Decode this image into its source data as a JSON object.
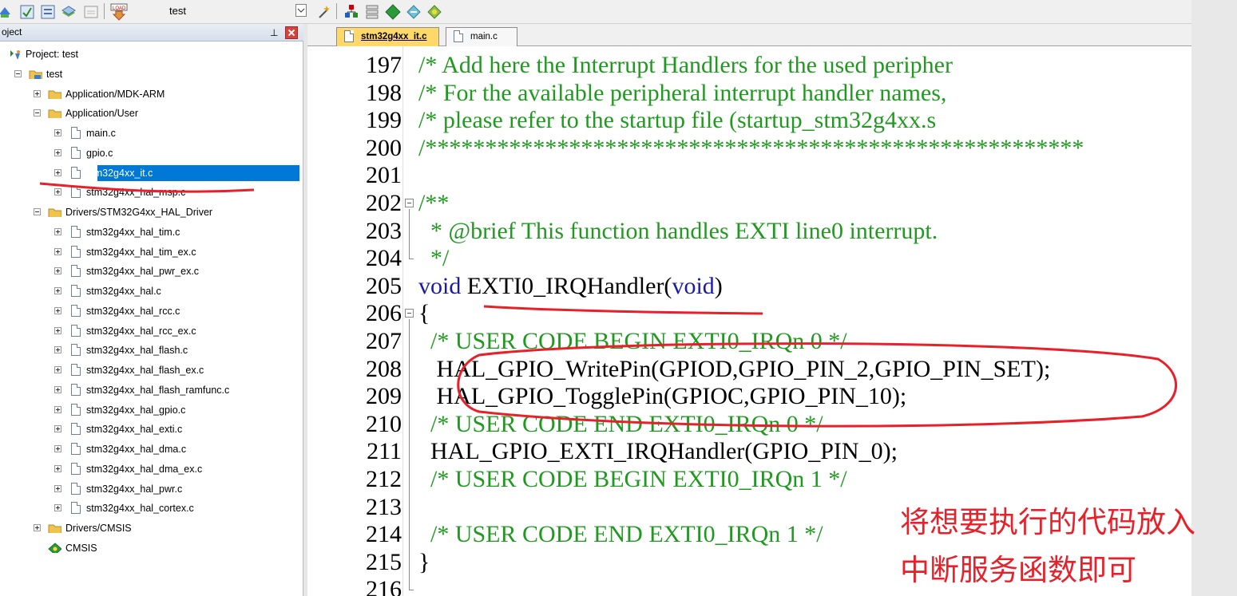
{
  "toolbar": {
    "target_name": "test",
    "icons": [
      "translate-icon",
      "build-icon",
      "rebuild-icon",
      "batch-build-icon",
      "stop-build-icon",
      "download-icon",
      "target-options-icon",
      "manage-project-icon",
      "manage-components-icon",
      "pack-installer-icon",
      "event-recorder-icon",
      "select-packs-icon"
    ],
    "download_label": "LOAD"
  },
  "project_panel": {
    "title": "oject",
    "pin_symbol": "⊥",
    "items": [
      {
        "label": "Project: test",
        "type": "project"
      },
      {
        "label": "test",
        "type": "target"
      },
      {
        "label": "Application/MDK-ARM",
        "type": "folder"
      },
      {
        "label": "Application/User",
        "type": "folder"
      },
      {
        "label": "main.c",
        "type": "file"
      },
      {
        "label": "gpio.c",
        "type": "file"
      },
      {
        "label": "stm32g4xx_it.c",
        "type": "file",
        "selected": true
      },
      {
        "label": "stm32g4xx_hal_msp.c",
        "type": "file"
      },
      {
        "label": "Drivers/STM32G4xx_HAL_Driver",
        "type": "folder"
      },
      {
        "label": "stm32g4xx_hal_tim.c",
        "type": "file"
      },
      {
        "label": "stm32g4xx_hal_tim_ex.c",
        "type": "file"
      },
      {
        "label": "stm32g4xx_hal_pwr_ex.c",
        "type": "file"
      },
      {
        "label": "stm32g4xx_hal.c",
        "type": "file"
      },
      {
        "label": "stm32g4xx_hal_rcc.c",
        "type": "file"
      },
      {
        "label": "stm32g4xx_hal_rcc_ex.c",
        "type": "file"
      },
      {
        "label": "stm32g4xx_hal_flash.c",
        "type": "file"
      },
      {
        "label": "stm32g4xx_hal_flash_ex.c",
        "type": "file"
      },
      {
        "label": "stm32g4xx_hal_flash_ramfunc.c",
        "type": "file"
      },
      {
        "label": "stm32g4xx_hal_gpio.c",
        "type": "file"
      },
      {
        "label": "stm32g4xx_hal_exti.c",
        "type": "file"
      },
      {
        "label": "stm32g4xx_hal_dma.c",
        "type": "file"
      },
      {
        "label": "stm32g4xx_hal_dma_ex.c",
        "type": "file"
      },
      {
        "label": "stm32g4xx_hal_pwr.c",
        "type": "file"
      },
      {
        "label": "stm32g4xx_hal_cortex.c",
        "type": "file"
      },
      {
        "label": "Drivers/CMSIS",
        "type": "folder"
      },
      {
        "label": "CMSIS",
        "type": "component"
      }
    ]
  },
  "editor": {
    "tabs": [
      {
        "label": "stm32g4xx_it.c",
        "active": true
      },
      {
        "label": "main.c",
        "active": false
      }
    ],
    "lines": [
      {
        "n": "197",
        "parts": [
          {
            "t": "/* Add here the Interrupt Handlers for the used peripher",
            "c": "cmt"
          }
        ]
      },
      {
        "n": "198",
        "parts": [
          {
            "t": "/* For the available peripheral interrupt handler names,",
            "c": "cmt"
          }
        ]
      },
      {
        "n": "199",
        "parts": [
          {
            "t": "/* please refer to the startup file (startup_stm32g4xx.s",
            "c": "cmt"
          }
        ]
      },
      {
        "n": "200",
        "parts": [
          {
            "t": "/*******************************************************",
            "c": "cmt"
          }
        ]
      },
      {
        "n": "201",
        "parts": []
      },
      {
        "n": "202",
        "parts": [
          {
            "t": "/**",
            "c": "cmt"
          }
        ]
      },
      {
        "n": "203",
        "parts": [
          {
            "t": "  * @brief This function handles EXTI line0 interrupt.",
            "c": "cmt"
          }
        ]
      },
      {
        "n": "204",
        "parts": [
          {
            "t": "  */",
            "c": "cmt"
          }
        ]
      },
      {
        "n": "205",
        "parts": [
          {
            "t": "void",
            "c": "kw"
          },
          {
            "t": " EXTI0_IRQHandler(",
            "c": "plain"
          },
          {
            "t": "void",
            "c": "kw"
          },
          {
            "t": ")",
            "c": "plain"
          }
        ]
      },
      {
        "n": "206",
        "parts": [
          {
            "t": "{",
            "c": "plain"
          }
        ]
      },
      {
        "n": "207",
        "parts": [
          {
            "t": "  /* USER CODE BEGIN EXTI0_IRQn 0 */",
            "c": "cmt"
          }
        ]
      },
      {
        "n": "208",
        "parts": [
          {
            "t": "   HAL_GPIO_WritePin(GPIOD,GPIO_PIN_2,GPIO_PIN_SET);",
            "c": "plain"
          }
        ]
      },
      {
        "n": "209",
        "parts": [
          {
            "t": "   HAL_GPIO_TogglePin(GPIOC,GPIO_PIN_10);",
            "c": "plain"
          }
        ]
      },
      {
        "n": "210",
        "parts": [
          {
            "t": "  /* USER CODE END EXTI0_IRQn 0 */",
            "c": "cmt"
          }
        ]
      },
      {
        "n": "211",
        "parts": [
          {
            "t": "  HAL_GPIO_EXTI_IRQHandler(GPIO_PIN_0);",
            "c": "plain"
          }
        ]
      },
      {
        "n": "212",
        "parts": [
          {
            "t": "  /* USER CODE BEGIN EXTI0_IRQn 1 */",
            "c": "cmt"
          }
        ]
      },
      {
        "n": "213",
        "parts": []
      },
      {
        "n": "214",
        "parts": [
          {
            "t": "  /* USER CODE END EXTI0_IRQn 1 */",
            "c": "cmt"
          }
        ]
      },
      {
        "n": "215",
        "parts": [
          {
            "t": "}",
            "c": "plain"
          }
        ]
      },
      {
        "n": "216",
        "parts": []
      }
    ]
  },
  "annotation": {
    "note_line1": "将想要执行的代码放入",
    "note_line2": "中断服务函数即可",
    "color": "#e8202a"
  }
}
